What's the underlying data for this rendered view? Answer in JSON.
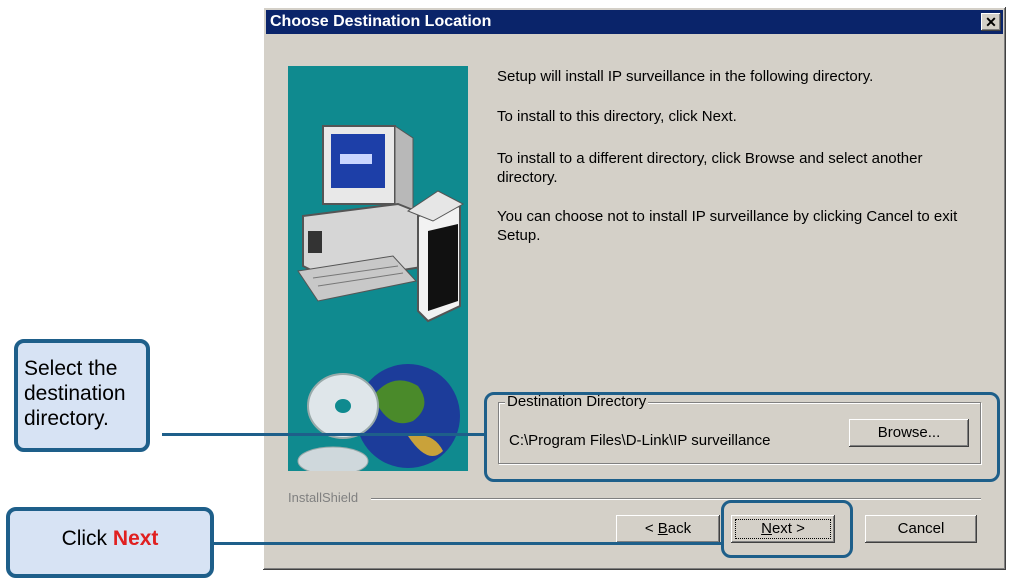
{
  "dialog": {
    "title": "Choose Destination Location",
    "close_glyph": "✕",
    "messages": [
      "Setup will install IP surveillance in the following directory.",
      "To install to this directory, click Next.",
      "To install to a different directory, click Browse and select another directory.",
      "You can choose not to install IP surveillance by clicking Cancel to exit Setup."
    ],
    "group_label": "Destination Directory",
    "destination_path": "C:\\Program Files\\D-Link\\IP surveillance",
    "browse_label": "Browse...",
    "branding": "InstallShield",
    "buttons": {
      "back_prefix": "< ",
      "back_underlined": "B",
      "back_suffix": "ack",
      "next_underlined": "N",
      "next_suffix": "ext >",
      "cancel": "Cancel"
    }
  },
  "callouts": {
    "directory": "Select the destination directory.",
    "next_prefix": "Click ",
    "next_emphasis": "Next"
  },
  "colors": {
    "titlebar": "#0a246a",
    "dialog_face": "#d4d0c8",
    "art_background": "#0f8a8f",
    "callout_fill": "#d7e3f4",
    "callout_border": "#1e5f8a",
    "emphasis": "#e02020"
  }
}
